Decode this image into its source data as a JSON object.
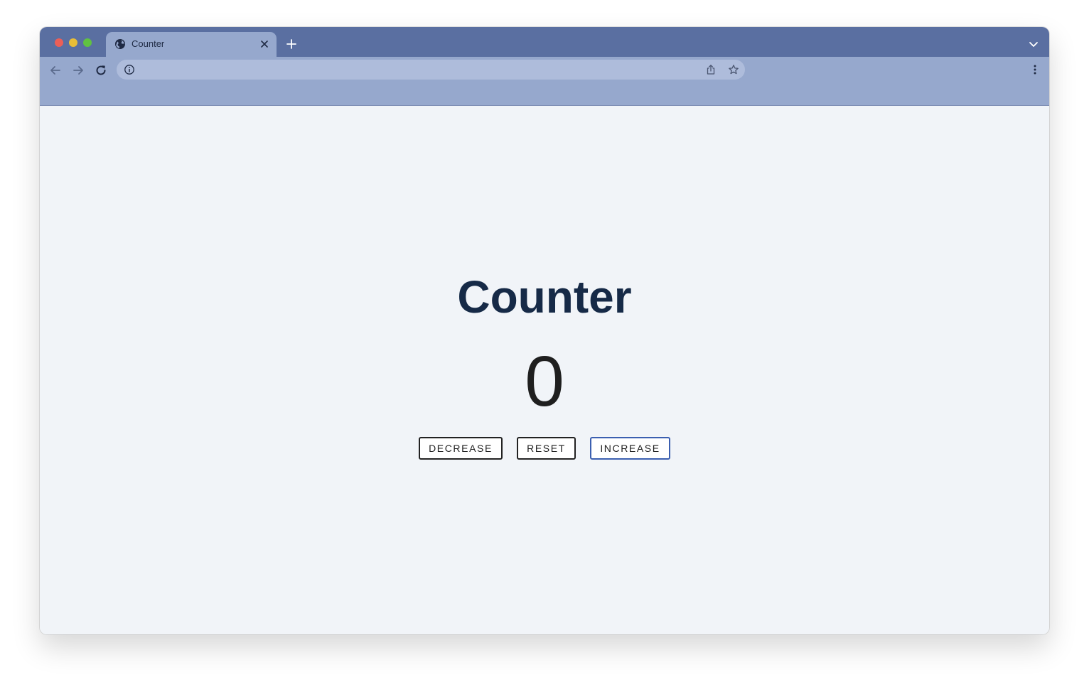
{
  "browser": {
    "tab_title": "Counter",
    "url": "",
    "titlebar_color": "#5a6fa1",
    "toolbar_color": "#96a8cd",
    "icons": {
      "favicon": "globe-icon",
      "tab_close": "close-icon",
      "new_tab": "plus-icon",
      "tab_menu": "chevron-down-icon",
      "back": "arrow-left-icon",
      "forward": "arrow-right-icon",
      "reload": "reload-icon",
      "site_info": "info-icon",
      "share": "share-icon",
      "bookmark": "star-icon",
      "menu": "kebab-menu-icon"
    }
  },
  "page": {
    "title": "Counter",
    "count": "0",
    "buttons": {
      "decrease": "DECREASE",
      "reset": "RESET",
      "increase": "INCREASE"
    },
    "colors": {
      "heading": "#162a47",
      "background": "#f1f4f8",
      "increase_border": "#3b5fb0"
    }
  }
}
